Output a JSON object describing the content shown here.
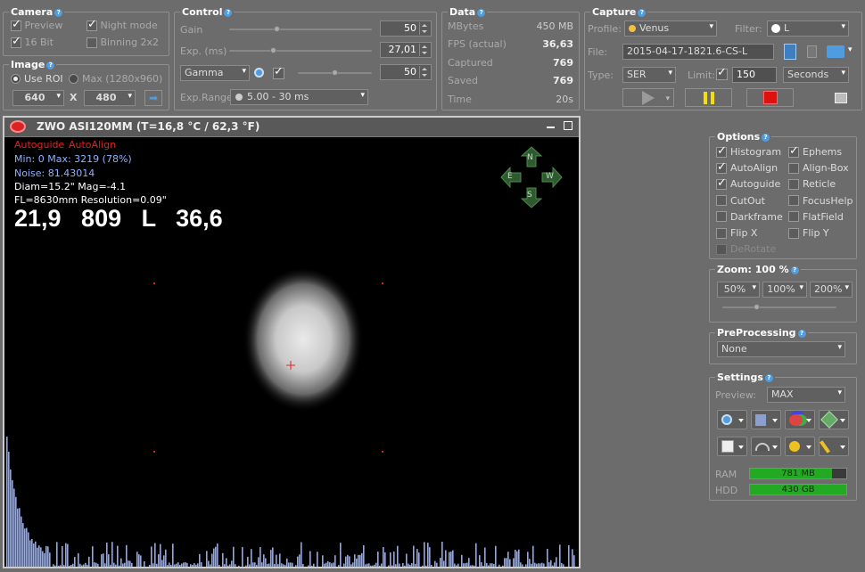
{
  "camera": {
    "title": "Camera",
    "preview": "Preview",
    "night_mode": "Night mode",
    "bit16": "16 Bit",
    "binning": "Binning 2x2"
  },
  "image": {
    "title": "Image",
    "use_roi": "Use ROI",
    "max": "Max (1280x960)",
    "width": "640",
    "x": "X",
    "height": "480"
  },
  "control": {
    "title": "Control",
    "gain_label": "Gain",
    "gain_value": "50",
    "gain_level": 0.33,
    "exp_label": "Exp. (ms)",
    "exp_value": "27,01",
    "exp_level": 0.3,
    "gamma_select": "Gamma",
    "gamma_value": "50",
    "gamma_level": 0.5,
    "exprange_label": "Exp.Range",
    "exprange_value": "5.00 - 30 ms"
  },
  "data": {
    "title": "Data",
    "rows": [
      {
        "label": "MBytes",
        "value": "450 MB",
        "bold": false
      },
      {
        "label": "FPS (actual)",
        "value": "36,63",
        "bold": true
      },
      {
        "label": "Captured",
        "value": "769",
        "bold": true
      },
      {
        "label": "Saved",
        "value": "769",
        "bold": true
      },
      {
        "label": "Time",
        "value": "20s",
        "bold": false
      }
    ]
  },
  "capture": {
    "title": "Capture",
    "profile_label": "Profile:",
    "profile_value": "Venus",
    "filter_label": "Filter:",
    "filter_value": "L",
    "file_label": "File:",
    "file_value": "2015-04-17-1821.6-CS-L",
    "type_label": "Type:",
    "type_value": "SER",
    "limit_label": "Limit:",
    "limit_value": "150",
    "limit_unit": "Seconds"
  },
  "preview": {
    "title": "ZWO ASI120MM   (T=16,8 °C / 62,3 °F)",
    "autoguide": "Autoguide",
    "autoalign": "AutoAlign",
    "minmax": "Min: 0     Max: 3219  (78%)",
    "noise": "Noise: 81.43014",
    "diam": "Diam=15.2\"   Mag=-4.1",
    "fl": "FL=8630mm   Resolution=0.09\"",
    "big": "21,9   809   L   36,6",
    "compass": {
      "n": "N",
      "s": "S",
      "e": "E",
      "w": "W"
    }
  },
  "options": {
    "title": "Options",
    "items": [
      {
        "label": "Histogram",
        "checked": true
      },
      {
        "label": "Ephems",
        "checked": true
      },
      {
        "label": "AutoAlign",
        "checked": true
      },
      {
        "label": "Align-Box",
        "checked": false
      },
      {
        "label": "Autoguide",
        "checked": true
      },
      {
        "label": "Reticle",
        "checked": false
      },
      {
        "label": "CutOut",
        "checked": false
      },
      {
        "label": "FocusHelp",
        "checked": false
      },
      {
        "label": "Darkframe",
        "checked": false
      },
      {
        "label": "FlatField",
        "checked": false
      },
      {
        "label": "Flip X",
        "checked": false
      },
      {
        "label": "Flip Y",
        "checked": false
      },
      {
        "label": "DeRotate",
        "checked": false
      }
    ]
  },
  "zoom": {
    "title": "Zoom: 100 %",
    "options": [
      "50%",
      "100%",
      "200%"
    ]
  },
  "preprocessing": {
    "title": "PreProcessing",
    "value": "None"
  },
  "settings": {
    "title": "Settings",
    "preview_label": "Preview:",
    "preview_value": "MAX",
    "ram_label": "RAM",
    "ram_value": "781 MB",
    "ram_level": 0.85,
    "hdd_label": "HDD",
    "hdd_value": "430 GB",
    "hdd_level": 1.0
  },
  "colors": {
    "accent": "#4f9de0",
    "red": "#e62020",
    "green_meter": "#22aa22",
    "record": "#e01010",
    "pause": "#f5e000"
  }
}
